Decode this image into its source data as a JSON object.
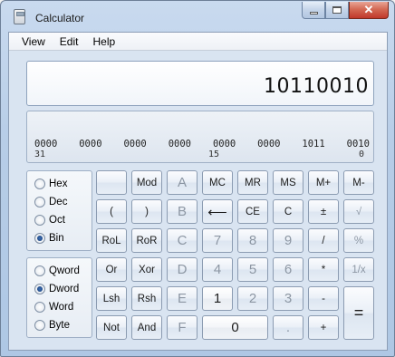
{
  "window": {
    "title": "Calculator",
    "close_glyph": "✕"
  },
  "menu": [
    "View",
    "Edit",
    "Help"
  ],
  "display": {
    "value": "10110010"
  },
  "bits": {
    "groups": [
      "0000",
      "0000",
      "0000",
      "0000",
      "0000",
      "0000",
      "1011",
      "0010"
    ],
    "labels": [
      "31",
      "15",
      "0"
    ]
  },
  "base_options": {
    "items": [
      "Hex",
      "Dec",
      "Oct",
      "Bin"
    ],
    "selected": "Bin"
  },
  "word_options": {
    "items": [
      "Qword",
      "Dword",
      "Word",
      "Byte"
    ],
    "selected": "Dword"
  },
  "keys": {
    "blank": "",
    "mod": "Mod",
    "A": "A",
    "mc": "MC",
    "mr": "MR",
    "ms": "MS",
    "mplus": "M+",
    "mminus": "M-",
    "lparen": "(",
    "rparen": ")",
    "B": "B",
    "backspace": "⟵",
    "ce": "CE",
    "c": "C",
    "negate": "±",
    "sqrt": "√",
    "rol": "RoL",
    "ror": "RoR",
    "C_hex": "C",
    "seven": "7",
    "eight": "8",
    "nine": "9",
    "divide": "/",
    "percent": "%",
    "or": "Or",
    "xor": "Xor",
    "D": "D",
    "four": "4",
    "five": "5",
    "six": "6",
    "multiply": "*",
    "reciprocal": "1/x",
    "lsh": "Lsh",
    "rsh": "Rsh",
    "E": "E",
    "one": "1",
    "two": "2",
    "three": "3",
    "minus": "-",
    "equals": "=",
    "not": "Not",
    "and": "And",
    "F": "F",
    "zero": "0",
    "decimal": ".",
    "plus": "+"
  }
}
